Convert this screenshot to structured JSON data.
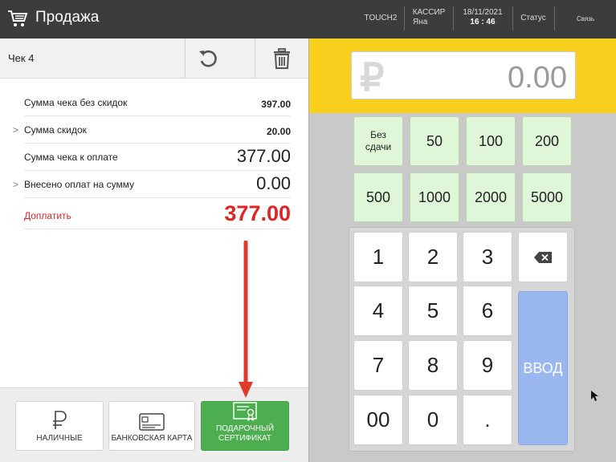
{
  "header": {
    "title": "Продажа",
    "device": "TOUCH2",
    "cashier_label": "КАССИР",
    "cashier_name": "Яна",
    "date": "18/11/2021",
    "time": "16 : 46",
    "status": "Статус",
    "connection": "Связь"
  },
  "check": {
    "title": "Чек 4",
    "rows": [
      {
        "label": "Сумма чека без скидок",
        "value": "397.00"
      },
      {
        "label": "Сумма скидок",
        "value": "20.00"
      },
      {
        "label": "Сумма чека к оплате",
        "value": "377.00"
      },
      {
        "label": "Внесено оплат на сумму",
        "value": "0.00"
      },
      {
        "label": "Доплатить",
        "value": "377.00"
      }
    ]
  },
  "payment_methods": {
    "cash": "НАЛИЧНЫЕ",
    "card": "БАНКОВСКАЯ КАРТА",
    "gift_line1": "ПОДАРОЧНЫЙ",
    "gift_line2": "СЕРТИФИКАТ"
  },
  "amount": {
    "currency": "₽",
    "value": "0.00"
  },
  "quick_amounts": {
    "no_change_line1": "Без",
    "no_change_line2": "сдачи",
    "values": [
      "50",
      "100",
      "200",
      "500",
      "1000",
      "2000",
      "5000"
    ]
  },
  "numpad": {
    "keys": [
      "1",
      "2",
      "3",
      "4",
      "5",
      "6",
      "7",
      "8",
      "9",
      "00",
      "0",
      "."
    ],
    "enter": "ВВОД"
  },
  "colors": {
    "accent_yellow": "#f7cf1c",
    "pay_green": "#4cae4f",
    "due_red": "#e02424",
    "enter_blue": "#9ab8ef"
  }
}
